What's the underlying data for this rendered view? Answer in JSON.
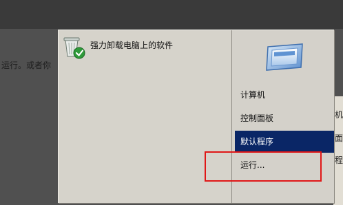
{
  "background": {
    "hint_text": "运行。或者你"
  },
  "start_menu": {
    "program": {
      "label": "强力卸载电脑上的软件",
      "icon": "uninstaller-icon"
    },
    "right_items": [
      {
        "label": "计算机",
        "active": false
      },
      {
        "label": "控制面板",
        "active": false
      },
      {
        "label": "默认程序",
        "active": true
      },
      {
        "label": "运行...",
        "active": false
      }
    ],
    "hero_icon": "window-icon"
  },
  "colors": {
    "active_item_bg": "#0a2666",
    "highlight_border": "#e01616",
    "menu_bg": "#d6d3cb"
  }
}
